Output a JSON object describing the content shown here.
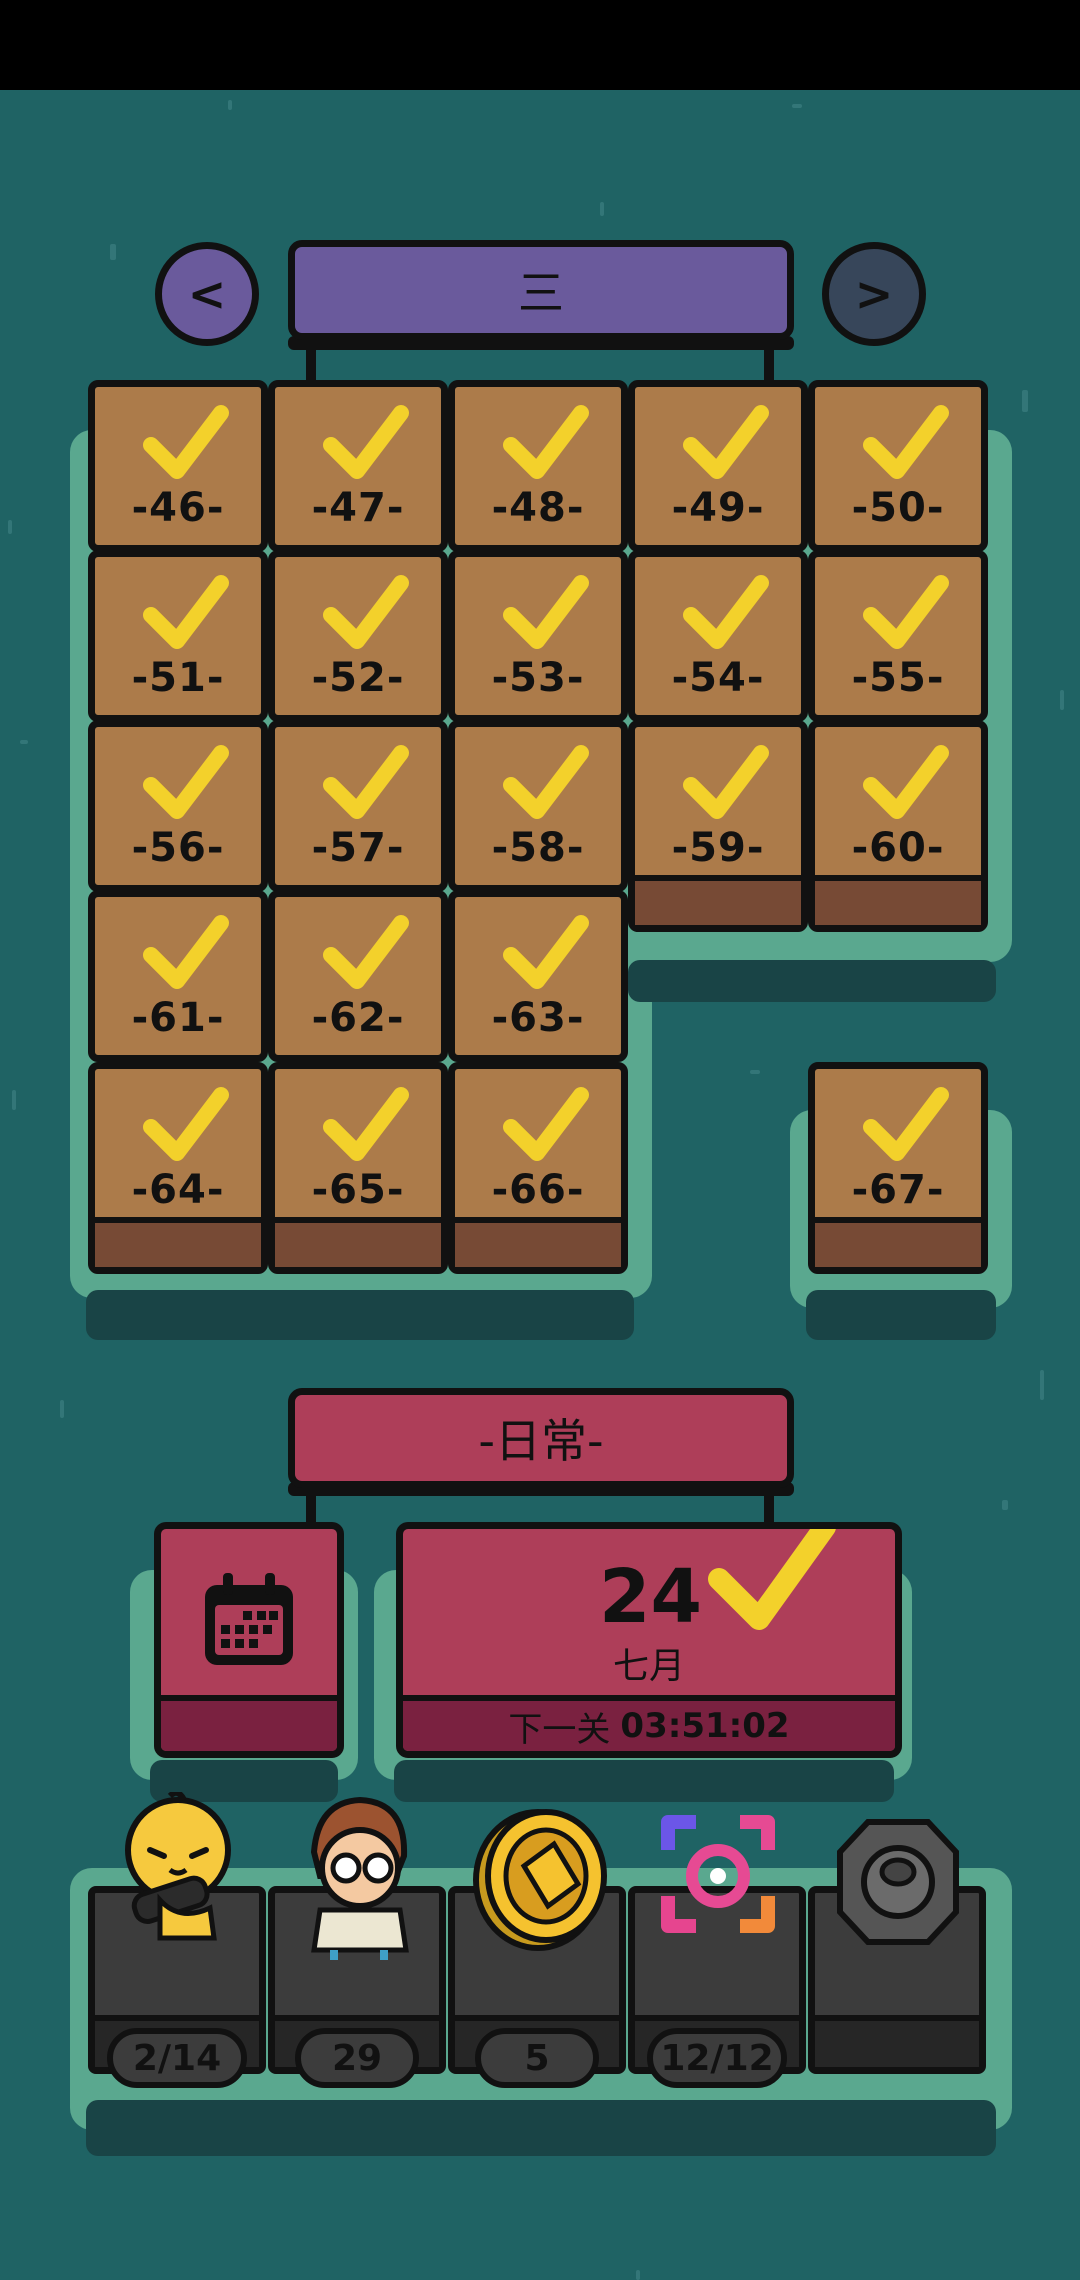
{
  "page": {
    "chapter_title": "三",
    "prev_label": "<",
    "next_label": ">"
  },
  "levels": [
    {
      "label": "-46-",
      "completed": true
    },
    {
      "label": "-47-",
      "completed": true
    },
    {
      "label": "-48-",
      "completed": true
    },
    {
      "label": "-49-",
      "completed": true
    },
    {
      "label": "-50-",
      "completed": true
    },
    {
      "label": "-51-",
      "completed": true
    },
    {
      "label": "-52-",
      "completed": true
    },
    {
      "label": "-53-",
      "completed": true
    },
    {
      "label": "-54-",
      "completed": true
    },
    {
      "label": "-55-",
      "completed": true
    },
    {
      "label": "-56-",
      "completed": true
    },
    {
      "label": "-57-",
      "completed": true
    },
    {
      "label": "-58-",
      "completed": true
    },
    {
      "label": "-59-",
      "completed": true
    },
    {
      "label": "-60-",
      "completed": true
    },
    {
      "label": "-61-",
      "completed": true
    },
    {
      "label": "-62-",
      "completed": true
    },
    {
      "label": "-63-",
      "completed": true
    },
    {
      "label": "-64-",
      "completed": true
    },
    {
      "label": "-65-",
      "completed": true
    },
    {
      "label": "-66-",
      "completed": true
    },
    {
      "label": "-67-",
      "completed": true
    }
  ],
  "daily": {
    "title": "-日常-",
    "day": "24",
    "month": "七月",
    "next_label": "下一关",
    "countdown": "03:51:02",
    "completed": true
  },
  "shelf": [
    {
      "icon": "chick-character-icon",
      "count": "2/14"
    },
    {
      "icon": "scientist-character-icon",
      "count": "29"
    },
    {
      "icon": "gold-coin-icon",
      "count": "5"
    },
    {
      "icon": "camera-focus-icon",
      "count": "12/12"
    },
    {
      "icon": "gear-icon",
      "count": ""
    }
  ],
  "colors": {
    "background": "#1f6364",
    "tile": "#ac7b4a",
    "check": "#f3d12b",
    "chapter_banner": "#6a5a9c",
    "daily_banner": "#ae3e59",
    "accent_teal": "#5aa88f"
  }
}
